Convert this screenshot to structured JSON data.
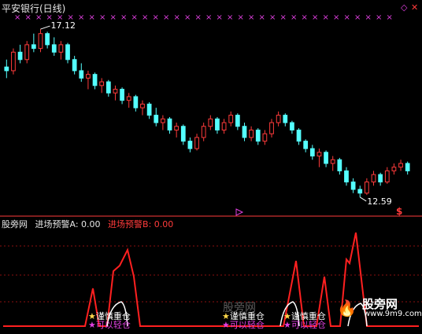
{
  "window": {
    "title": "平安银行(日线)"
  },
  "corner_icons": [
    "diamond-icon",
    "close-icon"
  ],
  "price_chart": {
    "high_label": "17.12",
    "low_label": "12.59",
    "marker_label": "$",
    "colors": {
      "up": "#ff3b3b",
      "down": "#54ffff",
      "cross": "#e040e0",
      "axis": "#ff3b3b"
    }
  },
  "indicator": {
    "name": "股旁网",
    "a_label": "进场预警A: 0.00",
    "b_label": "进场预警B: 0.00",
    "legend_groups": [
      {
        "yellow": "谨慎重仓",
        "magenta": "可以轻仓"
      },
      {
        "yellow": "谨慎重仓",
        "magenta": "可以轻仓"
      },
      {
        "yellow": "谨慎重仓",
        "magenta": "可以轻仓"
      }
    ],
    "colors": {
      "line": "#ff2020",
      "arc": "#ffffff"
    }
  },
  "watermarks": {
    "center": "股旁网",
    "right_logo": "股旁网",
    "right_url": "www.9m9.com"
  },
  "chart_data": {
    "type": "candlestick",
    "title": "平安银行(日线)",
    "price_annotations": {
      "high": 17.12,
      "low": 12.59
    },
    "candles_ohlc_estimated": [
      [
        16.1,
        16.3,
        15.8,
        16.0
      ],
      [
        16.0,
        16.6,
        15.9,
        16.5
      ],
      [
        16.5,
        16.7,
        16.2,
        16.3
      ],
      [
        16.3,
        16.8,
        16.2,
        16.7
      ],
      [
        16.7,
        17.0,
        16.5,
        16.6
      ],
      [
        16.6,
        17.12,
        16.5,
        17.0
      ],
      [
        17.0,
        17.05,
        16.6,
        16.7
      ],
      [
        16.7,
        16.9,
        16.4,
        16.5
      ],
      [
        16.5,
        16.8,
        16.3,
        16.7
      ],
      [
        16.7,
        16.75,
        16.2,
        16.3
      ],
      [
        16.3,
        16.4,
        15.9,
        16.0
      ],
      [
        16.0,
        16.2,
        15.7,
        15.8
      ],
      [
        15.8,
        16.0,
        15.5,
        15.9
      ],
      [
        15.9,
        15.95,
        15.5,
        15.6
      ],
      [
        15.6,
        15.8,
        15.4,
        15.7
      ],
      [
        15.7,
        15.75,
        15.3,
        15.4
      ],
      [
        15.4,
        15.6,
        15.2,
        15.5
      ],
      [
        15.5,
        15.55,
        15.1,
        15.2
      ],
      [
        15.2,
        15.4,
        15.0,
        15.3
      ],
      [
        15.3,
        15.35,
        14.9,
        15.0
      ],
      [
        15.0,
        15.2,
        14.8,
        15.1
      ],
      [
        15.1,
        15.15,
        14.7,
        14.8
      ],
      [
        14.8,
        15.0,
        14.5,
        14.6
      ],
      [
        14.6,
        14.8,
        14.4,
        14.7
      ],
      [
        14.7,
        14.75,
        14.3,
        14.4
      ],
      [
        14.4,
        14.6,
        14.2,
        14.5
      ],
      [
        14.5,
        14.55,
        14.0,
        14.1
      ],
      [
        14.1,
        14.2,
        13.8,
        13.9
      ],
      [
        13.9,
        14.3,
        13.85,
        14.2
      ],
      [
        14.2,
        14.6,
        14.1,
        14.5
      ],
      [
        14.5,
        14.8,
        14.4,
        14.7
      ],
      [
        14.7,
        14.75,
        14.3,
        14.4
      ],
      [
        14.4,
        14.7,
        14.3,
        14.6
      ],
      [
        14.6,
        14.9,
        14.5,
        14.8
      ],
      [
        14.8,
        14.85,
        14.4,
        14.5
      ],
      [
        14.5,
        14.6,
        14.1,
        14.2
      ],
      [
        14.2,
        14.5,
        14.1,
        14.4
      ],
      [
        14.4,
        14.45,
        14.0,
        14.1
      ],
      [
        14.1,
        14.4,
        14.0,
        14.3
      ],
      [
        14.3,
        14.7,
        14.2,
        14.6
      ],
      [
        14.6,
        14.9,
        14.5,
        14.8
      ],
      [
        14.8,
        14.85,
        14.5,
        14.6
      ],
      [
        14.6,
        14.65,
        14.3,
        14.4
      ],
      [
        14.4,
        14.45,
        14.0,
        14.1
      ],
      [
        14.1,
        14.15,
        13.8,
        13.9
      ],
      [
        13.9,
        14.0,
        13.6,
        13.7
      ],
      [
        13.7,
        13.9,
        13.4,
        13.8
      ],
      [
        13.8,
        13.85,
        13.4,
        13.5
      ],
      [
        13.5,
        13.7,
        13.3,
        13.6
      ],
      [
        13.6,
        13.65,
        13.2,
        13.3
      ],
      [
        13.3,
        13.4,
        12.9,
        13.0
      ],
      [
        13.0,
        13.1,
        12.7,
        12.8
      ],
      [
        12.8,
        12.9,
        12.59,
        12.7
      ],
      [
        12.7,
        13.1,
        12.65,
        13.0
      ],
      [
        13.0,
        13.3,
        12.9,
        13.2
      ],
      [
        13.2,
        13.25,
        12.9,
        13.0
      ],
      [
        13.0,
        13.4,
        12.95,
        13.3
      ],
      [
        13.3,
        13.5,
        13.2,
        13.4
      ],
      [
        13.4,
        13.6,
        13.3,
        13.5
      ],
      [
        13.5,
        13.55,
        13.2,
        13.3
      ]
    ]
  }
}
